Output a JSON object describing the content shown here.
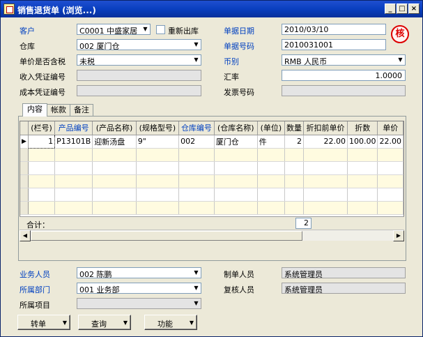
{
  "window": {
    "title": "销售退货单 (浏览...)",
    "min_label": "_",
    "max_label": "□",
    "close_label": "×"
  },
  "header": {
    "customer_label": "客户",
    "customer_value": "C0001  中盛家居",
    "reship_label": "重新出库",
    "date_label": "单据日期",
    "date_value": "2010/03/10",
    "warehouse_label": "仓库",
    "warehouse_value": "002  厦门仓",
    "doc_no_label": "单据号码",
    "doc_no_value": "2010031001",
    "tax_label": "单价是否含税",
    "tax_value": "未税",
    "currency_label": "币别",
    "currency_value": "RMB  人民币",
    "income_voucher_label": "收入凭证编号",
    "income_voucher_value": "",
    "rate_label": "汇率",
    "rate_value": "1.0000",
    "cost_voucher_label": "成本凭证编号",
    "cost_voucher_value": "",
    "invoice_label": "发票号码",
    "invoice_value": "",
    "seal_text": "核"
  },
  "tabs": [
    {
      "label": "内容"
    },
    {
      "label": "帐款"
    },
    {
      "label": "备注"
    }
  ],
  "grid": {
    "columns": [
      {
        "label": "(栏号)",
        "blue": false
      },
      {
        "label": "产品编号",
        "blue": true
      },
      {
        "label": "(产品名称)",
        "blue": false
      },
      {
        "label": "(规格型号)",
        "blue": false
      },
      {
        "label": "仓库编号",
        "blue": true
      },
      {
        "label": "(仓库名称)",
        "blue": false
      },
      {
        "label": "(单位)",
        "blue": false
      },
      {
        "label": "数量",
        "blue": false
      },
      {
        "label": "折扣前单价",
        "blue": false
      },
      {
        "label": "折数",
        "blue": false
      },
      {
        "label": "单价",
        "blue": false
      }
    ],
    "rows": [
      {
        "indicator": "▶",
        "line": "1",
        "product_no": "P13101B",
        "product_name": "迎新汤盘",
        "spec": "9\"",
        "wh_no": "002",
        "wh_name": "厦门仓",
        "unit": "件",
        "qty": "2",
        "price_before": "22.00",
        "discount": "100.00",
        "price": "22.00"
      }
    ],
    "total_label": "合计：",
    "total_qty": "2"
  },
  "footer": {
    "salesperson_label": "业务人员",
    "salesperson_value": "002  陈鹏",
    "maker_label": "制单人员",
    "maker_value": "系统管理员",
    "dept_label": "所属部门",
    "dept_value": "001  业务部",
    "reviewer_label": "复核人员",
    "reviewer_value": "系统管理员",
    "project_label": "所属项目",
    "project_value": "",
    "convert_button": "转单",
    "query_button": "查询",
    "function_button": "功能"
  },
  "colors": {
    "title_bar": "#0a3fbf",
    "label_blue": "#0040c0",
    "seal_red": "#d00000",
    "row_alt": "#fffbe0"
  }
}
